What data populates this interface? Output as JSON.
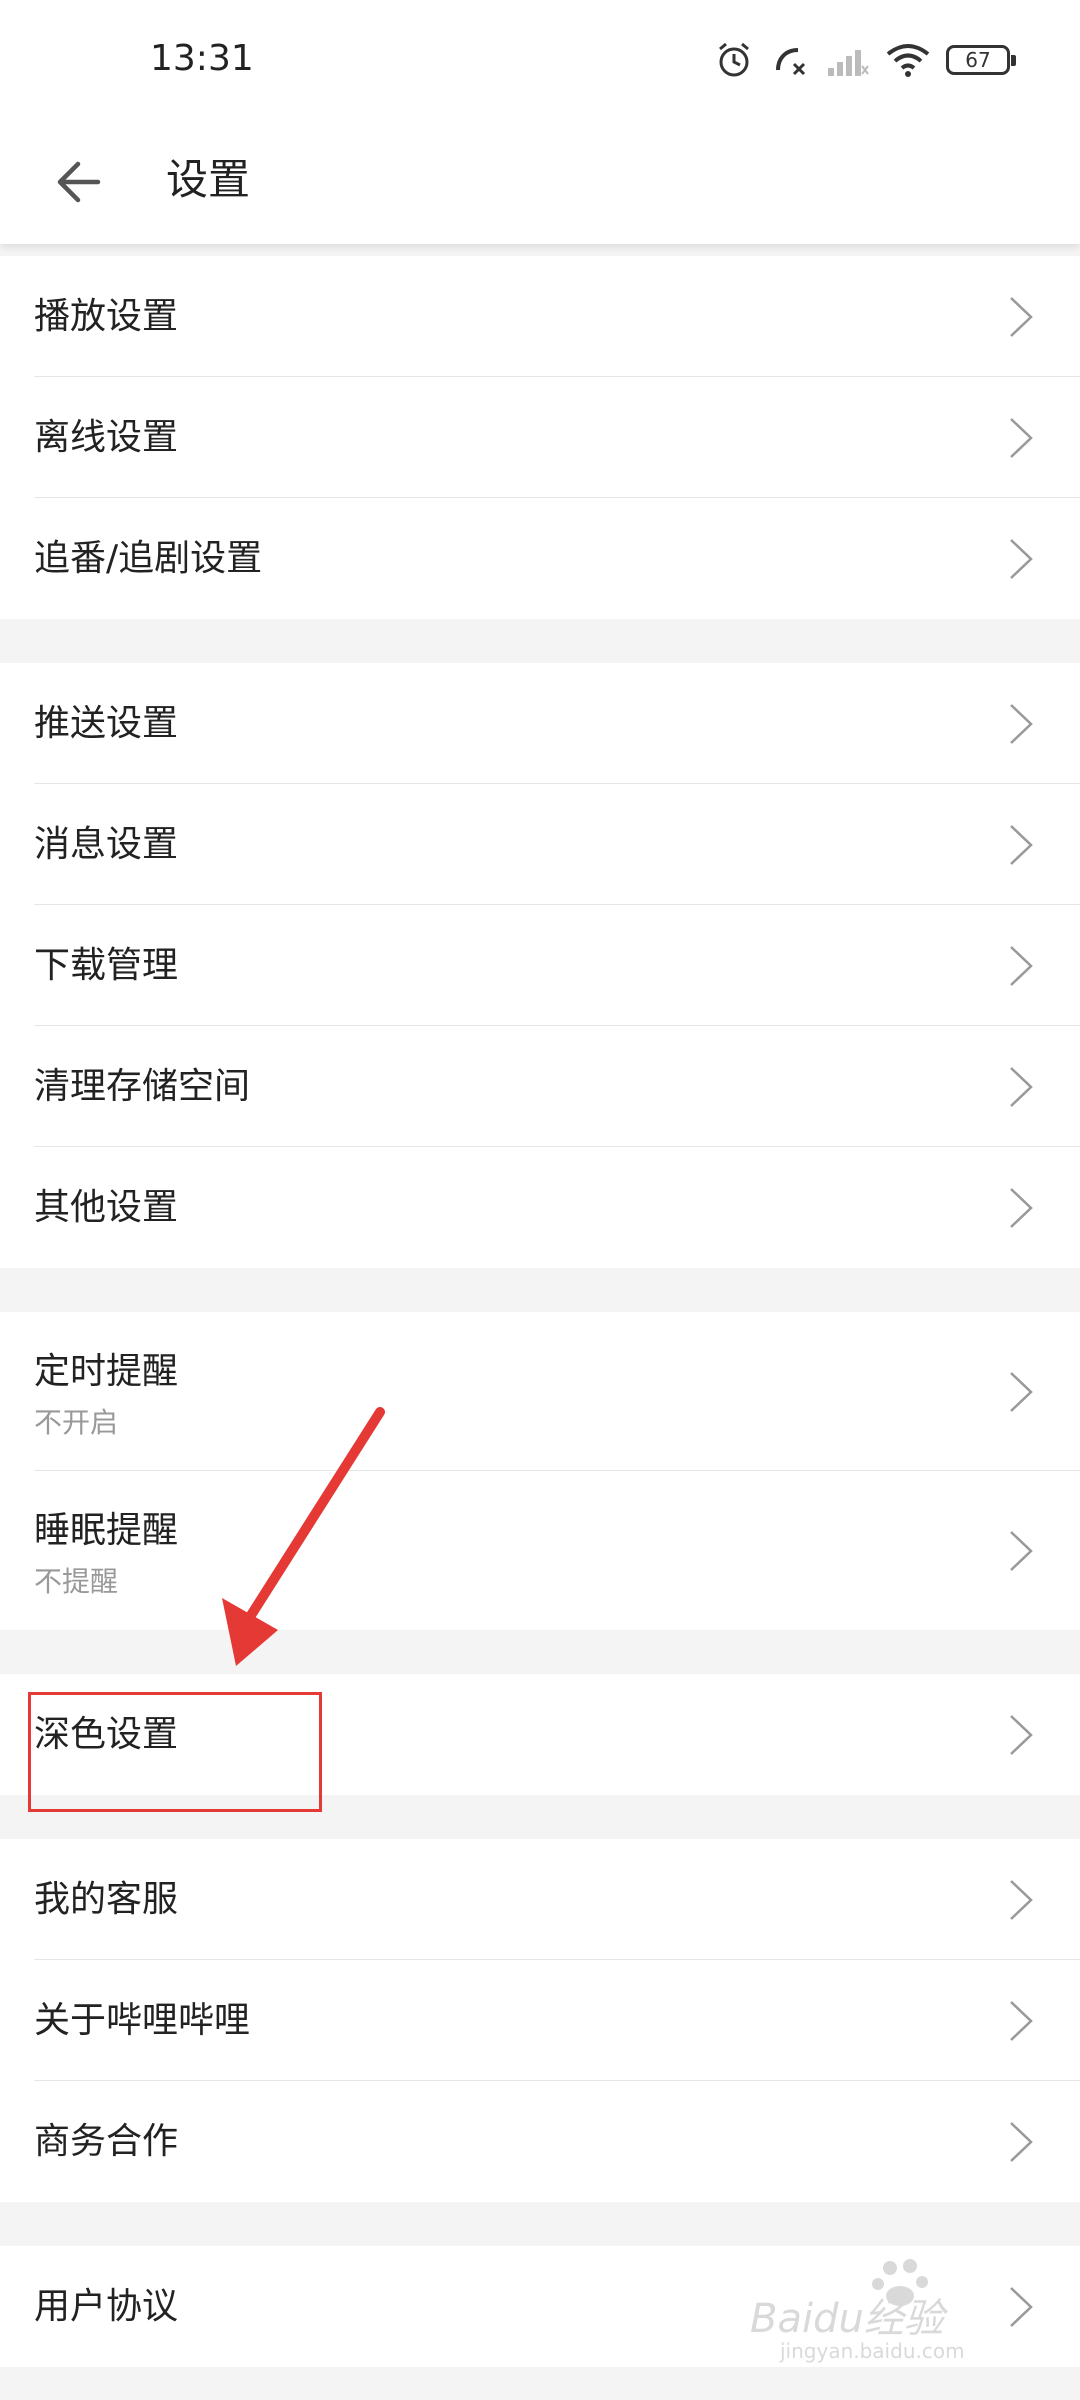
{
  "status_bar": {
    "time": "13:31",
    "battery": "67"
  },
  "header": {
    "title": "设置",
    "back_icon": "arrow-left-icon"
  },
  "groups": [
    {
      "items": [
        {
          "label": "播放设置"
        },
        {
          "label": "离线设置"
        },
        {
          "label": "追番/追剧设置"
        }
      ]
    },
    {
      "items": [
        {
          "label": "推送设置"
        },
        {
          "label": "消息设置"
        },
        {
          "label": "下载管理"
        },
        {
          "label": "清理存储空间"
        },
        {
          "label": "其他设置"
        }
      ]
    },
    {
      "items": [
        {
          "label": "定时提醒",
          "sub": "不开启"
        },
        {
          "label": "睡眠提醒",
          "sub": "不提醒"
        }
      ]
    },
    {
      "items": [
        {
          "label": "深色设置"
        }
      ]
    },
    {
      "items": [
        {
          "label": "我的客服"
        },
        {
          "label": "关于哔哩哔哩"
        },
        {
          "label": "商务合作"
        }
      ]
    },
    {
      "items": [
        {
          "label": "用户协议"
        }
      ]
    }
  ],
  "watermark": {
    "brand": "Baidu经验",
    "url": "jingyan.baidu.com"
  },
  "colors": {
    "annotation_red": "#e53935",
    "background": "#f4f4f4"
  }
}
